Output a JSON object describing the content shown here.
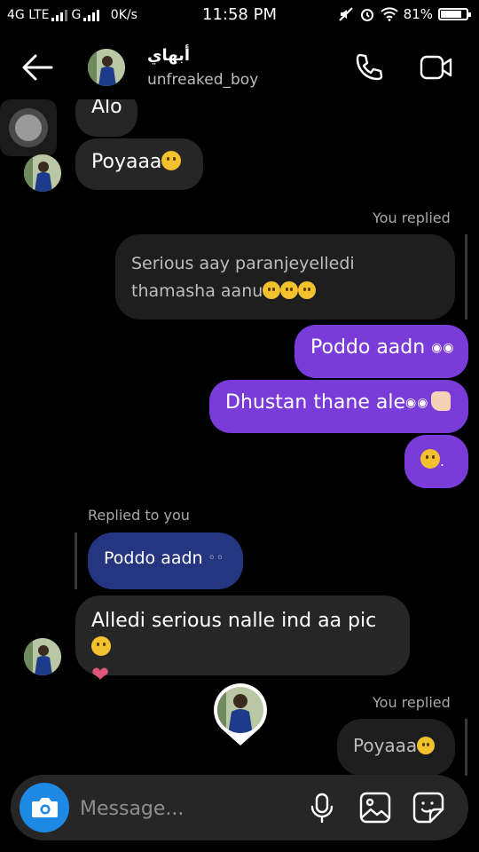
{
  "status_bar": {
    "network_left": "4G LTE",
    "network_right": "G",
    "speed": "0K/s",
    "time": "11:58 PM",
    "battery": "81%",
    "battery_level": 0.81
  },
  "header": {
    "contact_name": "أبهاي",
    "username": "unfreaked_boy"
  },
  "messages": {
    "m1": "Alo",
    "m2": "Poyaaa",
    "reply_label_1": "You replied",
    "quoted_1": "Serious aay paranjeyelledi thamasha aanu",
    "m3": "Poddo aadn",
    "m4": "Dhustan thane ale",
    "reply_label_2": "Replied to you",
    "quoted_2": "Poddo aadn",
    "m5_line1": "Alledi serious nalle ind aa pic",
    "reply_label_3": "You replied",
    "quoted_3": "Poyaaa"
  },
  "composer": {
    "placeholder": "Message..."
  },
  "colors": {
    "sent_bubble": "#7a3cd9",
    "received_bubble": "#262626",
    "quoted_sent": "#263580",
    "camera_button": "#1e88e5"
  }
}
